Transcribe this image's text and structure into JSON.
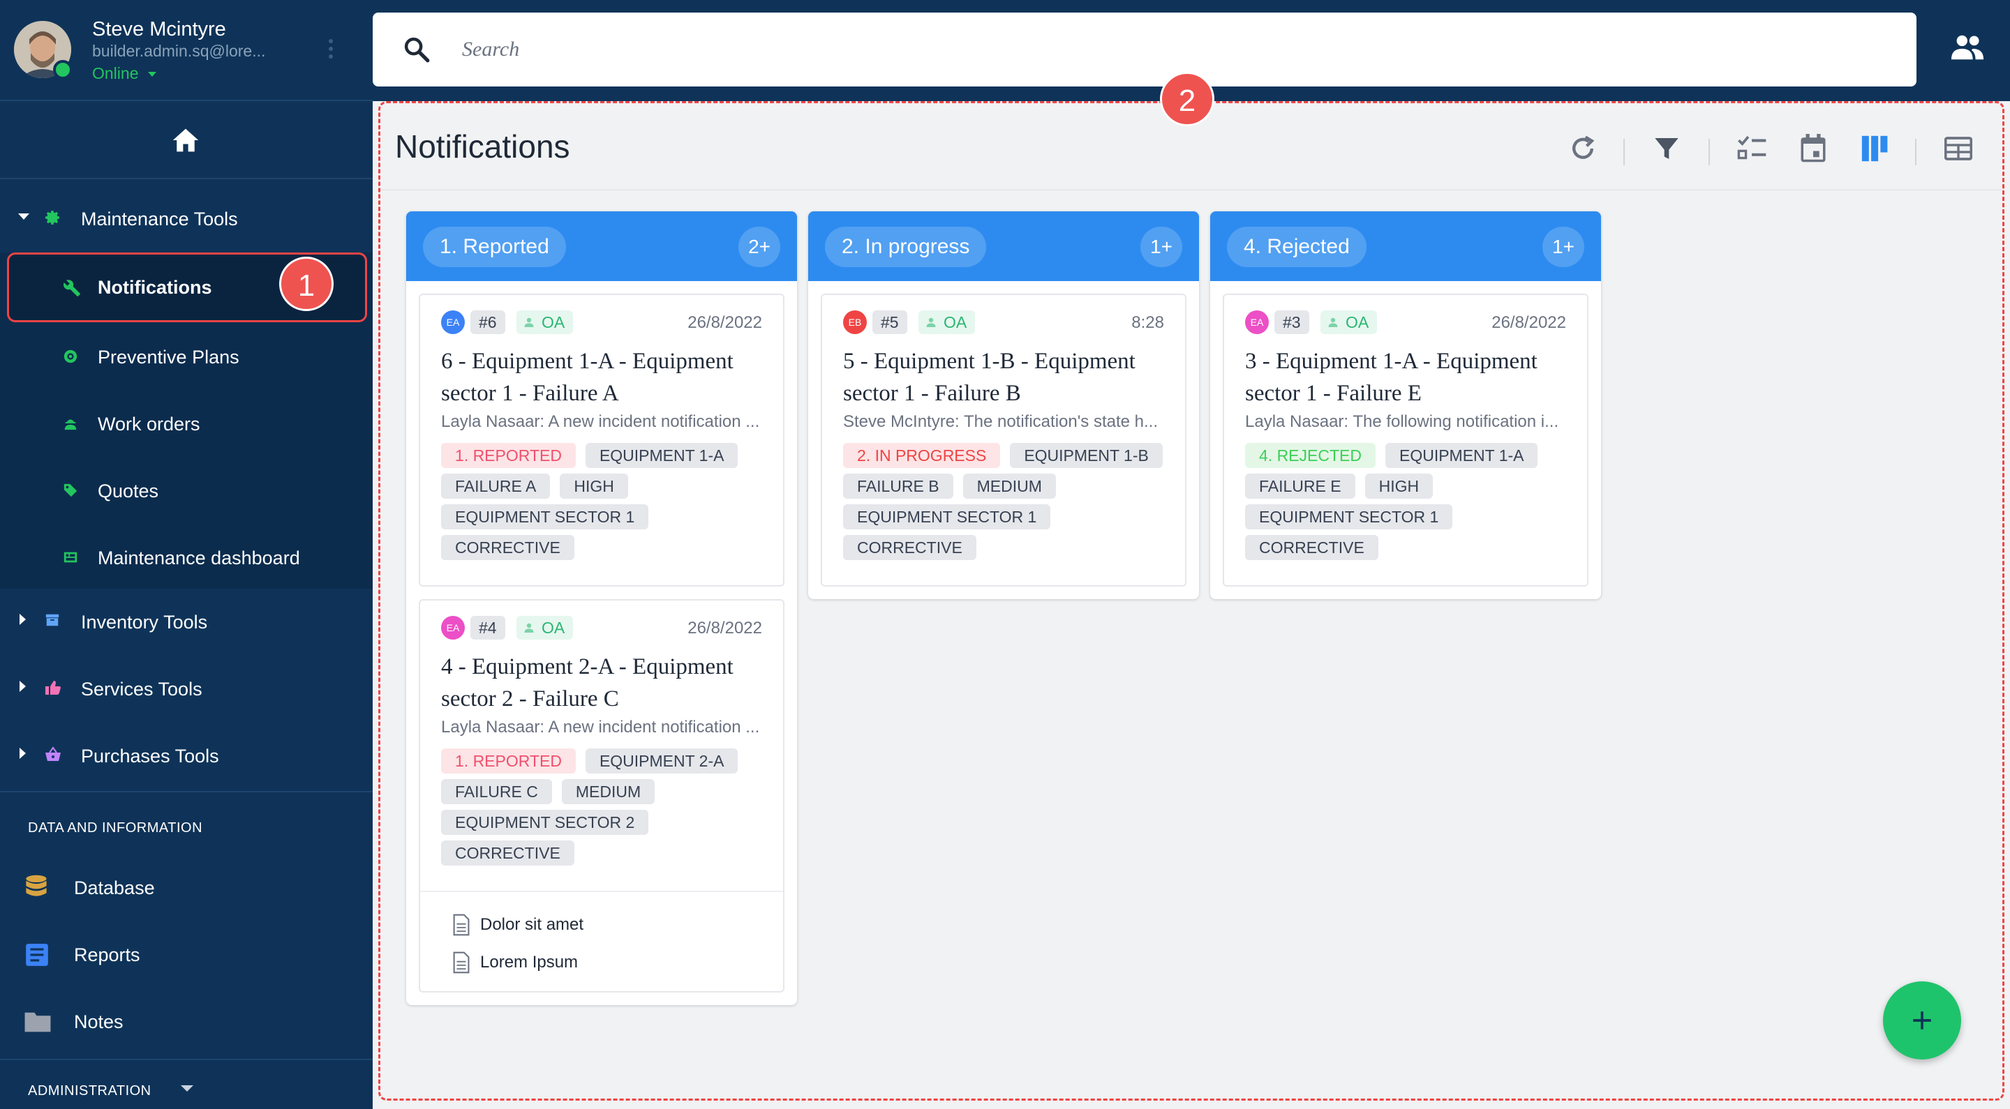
{
  "user": {
    "name": "Steve Mcintyre",
    "email": "builder.admin.sq@lore...",
    "status": "Online"
  },
  "sidebar": {
    "sections": [
      {
        "label": "Maintenance Tools",
        "icon": "gear-icon",
        "color": "#22c55e",
        "expanded": true
      },
      {
        "label": "Inventory Tools",
        "icon": "archive-icon",
        "color": "#60a5fa",
        "expanded": false
      },
      {
        "label": "Services Tools",
        "icon": "thumbs-up-icon",
        "color": "#f472b6",
        "expanded": false
      },
      {
        "label": "Purchases Tools",
        "icon": "basket-icon",
        "color": "#c084fc",
        "expanded": false
      }
    ],
    "maintenance_items": [
      {
        "label": "Notifications",
        "icon": "wrench-icon",
        "active": true
      },
      {
        "label": "Preventive Plans",
        "icon": "target-icon"
      },
      {
        "label": "Work orders",
        "icon": "worker-icon"
      },
      {
        "label": "Quotes",
        "icon": "tag-icon"
      },
      {
        "label": "Maintenance dashboard",
        "icon": "dashboard-icon"
      }
    ],
    "data_header": "DATA AND INFORMATION",
    "data_items": [
      {
        "label": "Database",
        "icon": "database-icon",
        "color": "#d9a441"
      },
      {
        "label": "Reports",
        "icon": "report-icon",
        "color": "#3b82f6"
      },
      {
        "label": "Notes",
        "icon": "folder-icon",
        "color": "#9ca3af"
      }
    ],
    "admin_header": "ADMINISTRATION"
  },
  "search": {
    "placeholder": "Search",
    "value": ""
  },
  "callouts": [
    "1",
    "2"
  ],
  "page": {
    "title": "Notifications",
    "toolbar": [
      "refresh-icon",
      "filter-icon",
      "checklist-icon",
      "calendar-icon",
      "kanban-icon",
      "table-icon"
    ]
  },
  "columns": [
    {
      "title": "1. Reported",
      "count": "2+",
      "cards": [
        {
          "avatar": "EA",
          "avatar_color": "#3b82f6",
          "id": "#6",
          "assignee": "OA",
          "date": "26/8/2022",
          "title": "6 - Equipment 1-A - Equipment sector 1 - Failure A",
          "description": "Layla Nasaar: A new incident notification ...",
          "tags": [
            {
              "text": "1. REPORTED",
              "kind": "st-reported"
            },
            {
              "text": "EQUIPMENT 1-A"
            },
            {
              "text": "FAILURE A"
            },
            {
              "text": "HIGH"
            },
            {
              "text": "EQUIPMENT SECTOR 1"
            },
            {
              "text": "CORRECTIVE"
            }
          ],
          "attachments": []
        },
        {
          "avatar": "EA",
          "avatar_color": "#ec4fc6",
          "id": "#4",
          "assignee": "OA",
          "date": "26/8/2022",
          "title": "4 - Equipment 2-A - Equipment sector 2 - Failure C",
          "description": "Layla Nasaar: A new incident notification ...",
          "tags": [
            {
              "text": "1. REPORTED",
              "kind": "st-reported"
            },
            {
              "text": "EQUIPMENT 2-A"
            },
            {
              "text": "FAILURE C"
            },
            {
              "text": "MEDIUM"
            },
            {
              "text": "EQUIPMENT SECTOR 2"
            },
            {
              "text": "CORRECTIVE"
            }
          ],
          "attachments": [
            "Dolor sit amet",
            "Lorem Ipsum"
          ]
        }
      ]
    },
    {
      "title": "2. In progress",
      "count": "1+",
      "cards": [
        {
          "avatar": "EB",
          "avatar_color": "#ef4444",
          "id": "#5",
          "assignee": "OA",
          "date": "8:28",
          "title": "5 - Equipment 1-B - Equipment sector 1 - Failure B",
          "description": "Steve McIntyre: The notification's state h...",
          "tags": [
            {
              "text": "2. IN PROGRESS",
              "kind": "st-progress"
            },
            {
              "text": "EQUIPMENT 1-B"
            },
            {
              "text": "FAILURE B"
            },
            {
              "text": "MEDIUM"
            },
            {
              "text": "EQUIPMENT SECTOR 1"
            },
            {
              "text": "CORRECTIVE"
            }
          ],
          "attachments": []
        }
      ]
    },
    {
      "title": "4. Rejected",
      "count": "1+",
      "cards": [
        {
          "avatar": "EA",
          "avatar_color": "#ec4fc6",
          "id": "#3",
          "assignee": "OA",
          "date": "26/8/2022",
          "title": "3 - Equipment 1-A - Equipment sector 1 - Failure E",
          "description": "Layla Nasaar: The following notification i...",
          "tags": [
            {
              "text": "4. REJECTED",
              "kind": "st-rejected"
            },
            {
              "text": "EQUIPMENT 1-A"
            },
            {
              "text": "FAILURE E"
            },
            {
              "text": "HIGH"
            },
            {
              "text": "EQUIPMENT SECTOR 1"
            },
            {
              "text": "CORRECTIVE"
            }
          ],
          "attachments": []
        }
      ]
    }
  ],
  "fab": {
    "icon": "plus-icon"
  }
}
